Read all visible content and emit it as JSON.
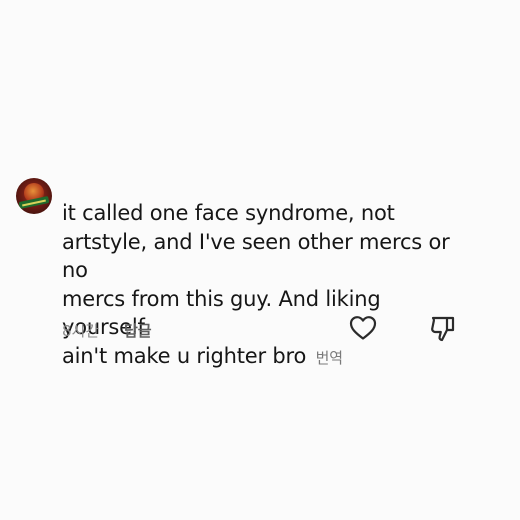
{
  "comment": {
    "lines": [
      "it called one face syndrome, not",
      "artstyle, and I've seen other mercs or no",
      "mercs from this guy. And liking yourself",
      "ain't make u righter bro"
    ],
    "translate_label": "번역",
    "time": "8시간",
    "reply_label": "답글"
  },
  "icons": {
    "like": "heart-icon",
    "dislike": "thumbs-down-icon"
  },
  "colors": {
    "background": "#fbfbfb",
    "text": "#161616",
    "muted": "#8a8a8a"
  }
}
